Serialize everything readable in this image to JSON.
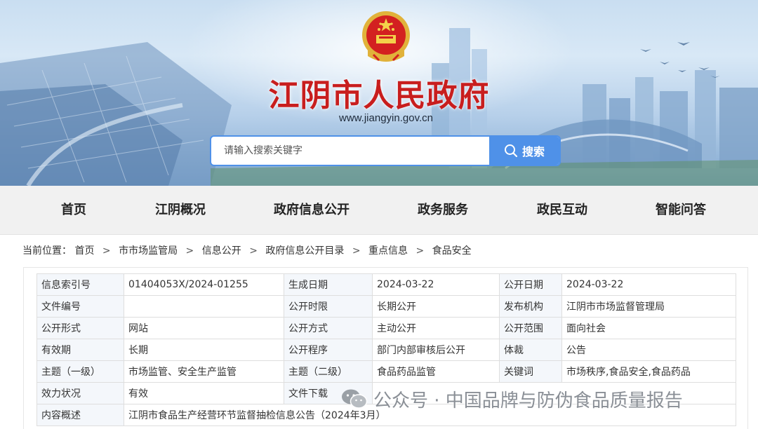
{
  "header": {
    "site_title": "江阴市人民政府",
    "site_url": "www.jiangyin.gov.cn"
  },
  "search": {
    "placeholder": "请输入搜索关键字",
    "button_label": "搜索"
  },
  "nav": {
    "items": [
      "首页",
      "江阴概况",
      "政府信息公开",
      "政务服务",
      "政民互动",
      "智能问答"
    ]
  },
  "breadcrumb": {
    "prefix": "当前位置：",
    "items": [
      "首页",
      "市市场监管局",
      "信息公开",
      "政府信息公开目录",
      "重点信息",
      "食品安全"
    ]
  },
  "info_table": {
    "rows": [
      [
        "信息索引号",
        "01404053X/2024-01255",
        "生成日期",
        "2024-03-22",
        "公开日期",
        "2024-03-22"
      ],
      [
        "文件编号",
        "",
        "公开时限",
        "长期公开",
        "发布机构",
        "江阴市市场监督管理局"
      ],
      [
        "公开形式",
        "网站",
        "公开方式",
        "主动公开",
        "公开范围",
        "面向社会"
      ],
      [
        "有效期",
        "长期",
        "公开程序",
        "部门内部审核后公开",
        "体裁",
        "公告"
      ],
      [
        "主题（一级）",
        "市场监管、安全生产监管",
        "主题（二级）",
        "食品药品监管",
        "关键词",
        "市场秩序,食品安全,食品药品"
      ],
      [
        "效力状况",
        "有效",
        "文件下载",
        "",
        "",
        ""
      ],
      [
        "内容概述",
        "江阴市食品生产经营环节监督抽检信息公告（2024年3月）"
      ]
    ]
  },
  "watermark": {
    "text": "公众号 · 中国品牌与防伪食品质量报告",
    "icon": "wechat-icon"
  },
  "colors": {
    "title_red": "#c81e1e",
    "search_blue": "#4f91e8",
    "nav_bg": "#f1f1f1",
    "label_bg": "#f4f7fb"
  }
}
